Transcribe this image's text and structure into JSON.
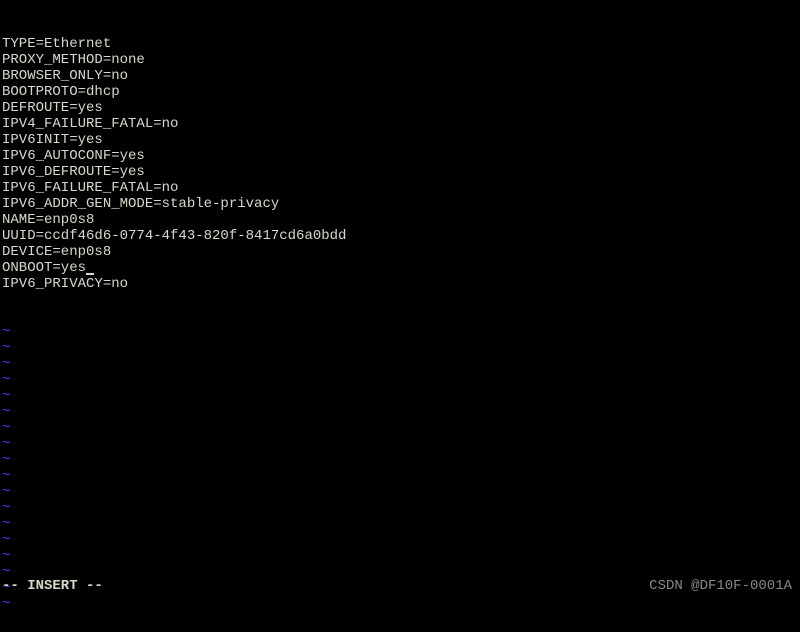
{
  "config_lines": [
    "TYPE=Ethernet",
    "PROXY_METHOD=none",
    "BROWSER_ONLY=no",
    "BOOTPROTO=dhcp",
    "DEFROUTE=yes",
    "IPV4_FAILURE_FATAL=no",
    "IPV6INIT=yes",
    "IPV6_AUTOCONF=yes",
    "IPV6_DEFROUTE=yes",
    "IPV6_FAILURE_FATAL=no",
    "IPV6_ADDR_GEN_MODE=stable-privacy",
    "NAME=enp0s8",
    "UUID=ccdf46d6-0774-4f43-820f-8417cd6a0bdd",
    "DEVICE=enp0s8",
    "ONBOOT=yes",
    "IPV6_PRIVACY=no"
  ],
  "cursor_line_index": 14,
  "tilde_count": 18,
  "tilde_char": "~",
  "status": "-- INSERT --",
  "watermark": "CSDN @DF10F-0001A"
}
